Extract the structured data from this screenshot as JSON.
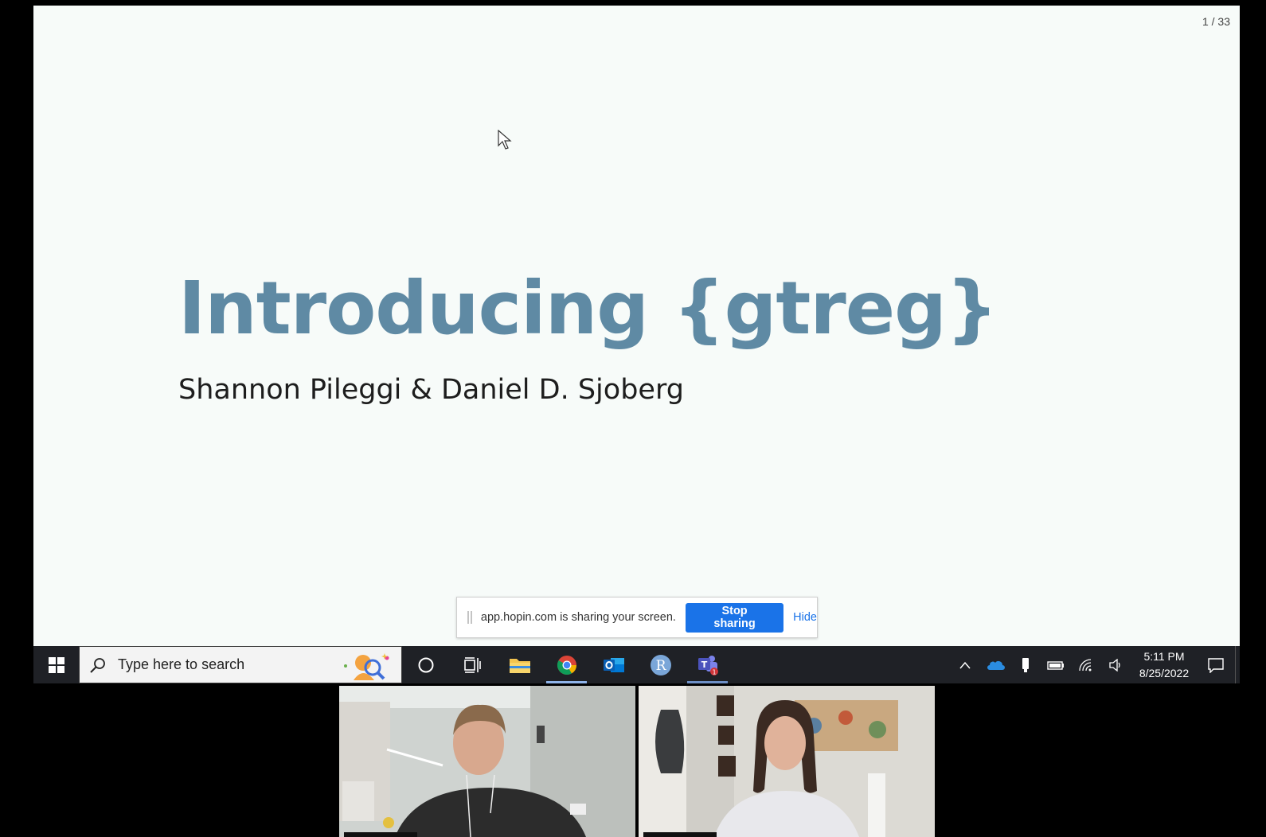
{
  "slide": {
    "page_counter": "1 / 33",
    "title": "Introducing {gtreg}",
    "subtitle": "Shannon Pileggi & Daniel D. Sjoberg"
  },
  "share_bar": {
    "message": "app.hopin.com is sharing your screen.",
    "stop_label": "Stop sharing",
    "hide_label": "Hide"
  },
  "taskbar": {
    "search_placeholder": "Type here to search",
    "apps": [
      {
        "name": "cortana",
        "icon": "circle-icon"
      },
      {
        "name": "task-view",
        "icon": "task-view-icon"
      },
      {
        "name": "file-explorer",
        "icon": "folder-icon"
      },
      {
        "name": "chrome",
        "icon": "chrome-icon",
        "active": true
      },
      {
        "name": "outlook",
        "icon": "outlook-icon"
      },
      {
        "name": "r",
        "icon": "r-icon",
        "label": "R"
      },
      {
        "name": "teams",
        "icon": "teams-icon",
        "badge": "1",
        "running": true
      }
    ],
    "clock": {
      "time": "5:11 PM",
      "date": "8/25/2022"
    }
  },
  "colors": {
    "slide_bg": "#f7fbf9",
    "title": "#5f8aa4",
    "stop_button": "#1a73e8",
    "taskbar": "#1f2126"
  }
}
